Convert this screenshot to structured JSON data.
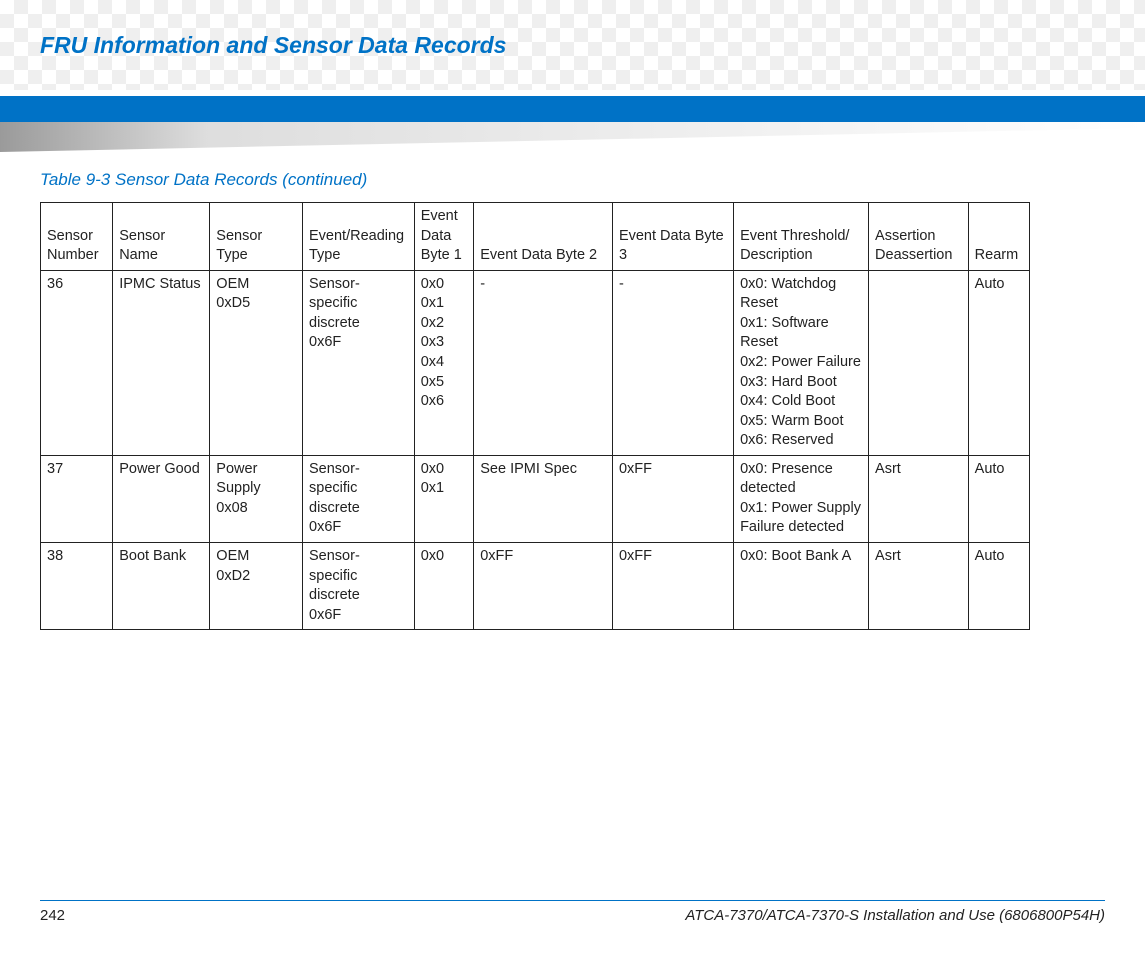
{
  "header": {
    "title": "FRU Information and Sensor Data Records"
  },
  "table": {
    "caption": "Table 9-3 Sensor Data Records  (continued)",
    "columns": [
      "Sensor Number",
      "Sensor Name",
      "Sensor Type",
      "Event/Reading Type",
      "Event Data Byte 1",
      "Event Data Byte 2",
      "Event Data Byte 3",
      "Event Threshold/ Description",
      "Assertion Deassertion",
      "Rearm"
    ],
    "rows": [
      {
        "number": "36",
        "name": "IPMC Status",
        "type": "OEM\n0xD5",
        "ert": "Sensor-specific\ndiscrete\n0x6F",
        "b1": "0x0\n0x1\n0x2\n0x3\n0x4\n0x5\n0x6",
        "b2": "-",
        "b3": "-",
        "threshold": "0x0: Watchdog Reset\n0x1: Software Reset\n0x2: Power Failure\n0x3: Hard Boot\n0x4: Cold Boot\n0x5: Warm Boot\n0x6: Reserved",
        "assert": "",
        "rearm": "Auto"
      },
      {
        "number": "37",
        "name": "Power Good",
        "type": "Power Supply\n0x08",
        "ert": "Sensor-specific\ndiscrete\n0x6F",
        "b1": "0x0\n0x1",
        "b2": "See IPMI Spec",
        "b3": "0xFF",
        "threshold": "0x0: Presence detected\n0x1: Power Supply Failure detected",
        "assert": "Asrt",
        "rearm": "Auto"
      },
      {
        "number": "38",
        "name": "Boot Bank",
        "type": "OEM\n0xD2",
        "ert": "Sensor-specific\ndiscrete\n0x6F",
        "b1": "0x0",
        "b2": "0xFF",
        "b3": "0xFF",
        "threshold": "0x0: Boot Bank A",
        "assert": "Asrt",
        "rearm": "Auto"
      }
    ]
  },
  "footer": {
    "page": "242",
    "doc": "ATCA-7370/ATCA-7370-S Installation and Use (6806800P54H)"
  }
}
